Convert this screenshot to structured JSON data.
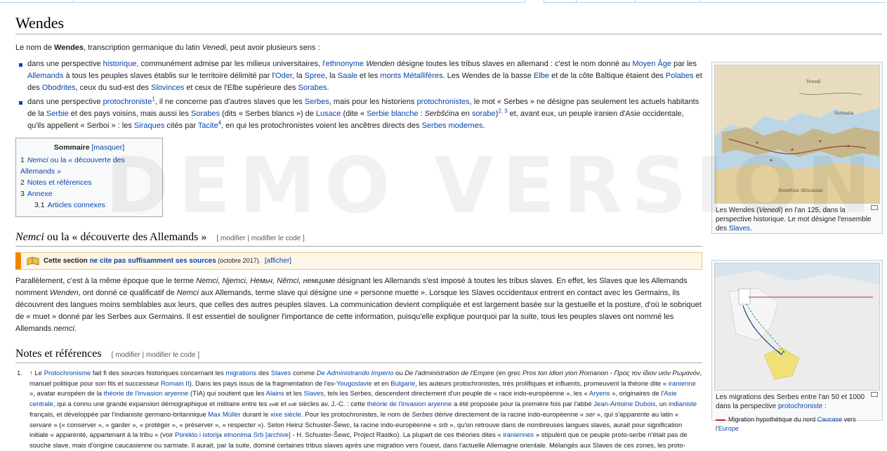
{
  "title": "Wendes",
  "intro": {
    "pre": "Le nom de ",
    "bold": "Wendes",
    "mid": ", transcription germanique du latin ",
    "italic": "Venedi",
    "post": ", peut avoir plusieurs sens :"
  },
  "bullet1": {
    "t1": "dans une perspective ",
    "l1": "historique",
    "t2": ", communément admise par les milieux universitaires, ",
    "l2": "l'ethnonyme",
    "t3": " ",
    "i1": "Wenden",
    "t4": " désigne toutes les tribus slaves en allemand : c'est le nom donné au ",
    "l3": "Moyen Âge",
    "t5": " par les ",
    "l4": "Allemands",
    "t6": " à tous les peuples slaves établis sur le territoire délimité par l'",
    "l5": "Oder",
    "t7": ", la ",
    "l6": "Spree",
    "t8": ", la ",
    "l7": "Saale",
    "t9": " et les ",
    "l8": "monts Métallifères",
    "t10": ". Les Wendes de la basse ",
    "l9": "Elbe",
    "t11": " et de la côte Baltique étaient des ",
    "l10": "Polabes",
    "t12": " et des ",
    "l11": "Obodrites",
    "t13": ", ceux du sud-est des ",
    "l12": "Slovinces",
    "t14": " et ceux de l'Elbe supérieure des ",
    "l13": "Sorabes",
    "t15": "."
  },
  "bullet2": {
    "t1": "dans une perspective ",
    "l1": "protochroniste",
    "s1": "1",
    "t2": ", il ne concerne pas d'autres slaves que les ",
    "l2": "Serbes",
    "t3": ", mais pour les historiens ",
    "l3": "protochronistes",
    "t4": ", le mot « Serbes » ne désigne pas seulement les actuels habitants de la ",
    "l4": "Serbie",
    "t5": " et des pays voisins, mais aussi les ",
    "l5": "Sorabes",
    "t6": " (dits « Serbes blancs ») de ",
    "l6": "Lusace",
    "t7": " (dite « ",
    "l7": "Serbie blanche",
    "t8": " : ",
    "i1": "Serbšćina",
    "t9": " en ",
    "l8": "sorabe",
    "t9b": ")",
    "s2": "2, 3",
    "t10": " et, avant eux, un peuple iranien d'Asie occidentale, qu'ils appellent « Serboi » : les ",
    "l9": "Siraques",
    "t11": " cités par ",
    "l10": "Tacite",
    "s3": "4",
    "t12": ", en qui les protochronistes voient les ancêtres directs des ",
    "l11": "Serbes modernes",
    "t13": "."
  },
  "toc": {
    "title": "Sommaire",
    "toggle": "[masquer]",
    "items": [
      {
        "num": "1",
        "it": "Nemci",
        "label": " ou la « découverte des Allemands »"
      },
      {
        "num": "2",
        "label": "Notes et références"
      },
      {
        "num": "3",
        "label": "Annexe"
      },
      {
        "num": "3.1",
        "label": "Articles connexes"
      }
    ]
  },
  "section1": {
    "title_it": "Nemci",
    "title": " ou la « découverte des Allemands »",
    "edit": "[ modifier | modifier le code ]"
  },
  "ambox": {
    "pre": "Cette section ",
    "link": "ne cite pas suffisamment ses sources",
    "date": " (octobre 2017).",
    "show": "[afficher]"
  },
  "para1": {
    "t1": "Parallèlement, c'est à la même époque que le terme ",
    "i1": "Nemci, Njemci, Немьч, Němci, немциме",
    "t2": " désignant les Allemands s'est imposé à toutes les tribus slaves. En effet, les Slaves que les Allemands nomment ",
    "i2": "Wenden",
    "t3": ", ont donné ce qualificatif de ",
    "i3": "Nemci",
    "t4": " aux Allemands, terme slave qui désigne une « personne muette ». Lorsque les Slaves occidentaux entrent en contact avec les Germains, ils découvrent des langues moins semblables aux leurs, que celles des autres peuples slaves. La communication devient compliquée et est largement basée sur la gestuelle et la posture, d'où le sobriquet de « muet » donné par les Serbes aux Germains. Il est essentiel de souligner l'importance de cette information, puisqu'elle explique pourquoi par la suite, tous les peuples slaves ont nommé les Allemands ",
    "i4": "nemci",
    "t5": "."
  },
  "section2": {
    "title": "Notes et références",
    "edit": "[ modifier | modifier le code ]"
  },
  "ref1": {
    "num": "1.",
    "arrow": "↑",
    "t1": " Le ",
    "l1": "Protochronisme",
    "t2": " fait fi des sources historiques concernant les ",
    "l2": "migrations",
    "t3": " des ",
    "l3": "Slaves",
    "t4": " comme ",
    "l4": "De Administrando Imperio",
    "t5": " ou ",
    "i1": "De l'administration de l'Empire",
    "t6": " (en grec ",
    "i2": "Pros ton idion yion Romanon - Προς τον ίδιον υιόν Ρωμανόν",
    "t7": ", manuel politique pour son fils et successeur ",
    "l5": "Romain II",
    "t8": "). Dans les pays issus de la fragmentation de l'ex-",
    "l6": "Yougoslavie",
    "t9": " et en ",
    "l7": "Bulgarie",
    "t10": ", les auteurs protochronistes, très prolifiques et influents, promeuvent la théorie dite « ",
    "l8": "iranienne",
    "t11": " », avatar européen de la ",
    "l9": "théorie de l'invasion aryenne",
    "t12": " (TIA) qui soutient que les ",
    "l10": "Alains",
    "t13": " et les ",
    "l11": "Slaves",
    "t14": ", tels les Serbes, descendent directement d'un peuple de « race indo-européenne », les « ",
    "l12": "Aryens",
    "t15": " », originaires de l'",
    "l13": "Asie centrale",
    "t16": ", qui a connu une grande expansion démographique et militaire entre les ",
    "sc1": "xvi",
    "t17": "e et ",
    "sc2": "xv",
    "t18": "e siècles av. J.-C. : cette ",
    "l14": "théorie de l'invasion aryenne",
    "t19": " a été proposée pour la première fois par l'abbé ",
    "l15": "Jean-Antoine Dubois",
    "t20": ", un ",
    "l16": "indianiste",
    "t21": " français, et développée par l'indianiste germano-britannique ",
    "l17": "Max Müller",
    "t22": " durant le ",
    "l18": "xixe siècle",
    "t23": ". Pour les protochronistes, le nom de ",
    "i3": "Serbes",
    "t24": " dérive directement de la racine indo-européenne « ",
    "i4": "ser",
    "t25": " », qui s'apparente au latin « ",
    "i5": "servare",
    "t26": " » (« conserver », « garder », « protéger », « préserver », « respecter »). Selon Heinz Schuster-Šewc, la racine indo-européenne « ",
    "i6": "srb",
    "t27": " », qu'on retrouve dans de nombreuses langues slaves, aurait pour signification initiale « apparenté, appartenant à la tribu » (voir ",
    "l19": "Poreklo i istorija etnonima Srb",
    "t28": " ",
    "l20": "[archive]",
    "t29": " - H. Schuster-Šewc, Project Rastko). La plupart de ces théories dites « ",
    "l21": "iraniennes",
    "t30": " » stipulent que ce peuple proto-serbe n'était pas de souche slave, mais d'origine caucasienne ou sarmate. Il aurait, par la suite, dominé certaines tribus slaves après une migration vers l'ouest, dans l'actuelle Allemagne orientale. Mélangés aux Slaves de ces zones, les proto-"
  },
  "figure1": {
    "cap1": "Les Wendes (",
    "cap_it": "Venedi",
    "cap2": ") en l'an 125, dans la perspective historique. Le mot désigne l'ensemble des ",
    "cap_link": "Slaves",
    "cap3": ".",
    "map_labels": [
      "Venedi",
      "Sarmatia",
      "Desertum Africanum"
    ]
  },
  "figure2": {
    "cap1": "Les migrations des Serbes entre l'an 50 et 1000 dans la perspective ",
    "cap_link": "protochroniste",
    "cap2": " :",
    "legend_pre": "Migration hypothétique du nord ",
    "legend_link1": "Caucase",
    "legend_mid": " vers l'",
    "legend_link2": "Europe"
  },
  "watermark": "DEMO VERSION",
  "colors": {
    "link": "#0645ad",
    "ambox_accent": "#f28500",
    "watermark": "#000000"
  }
}
